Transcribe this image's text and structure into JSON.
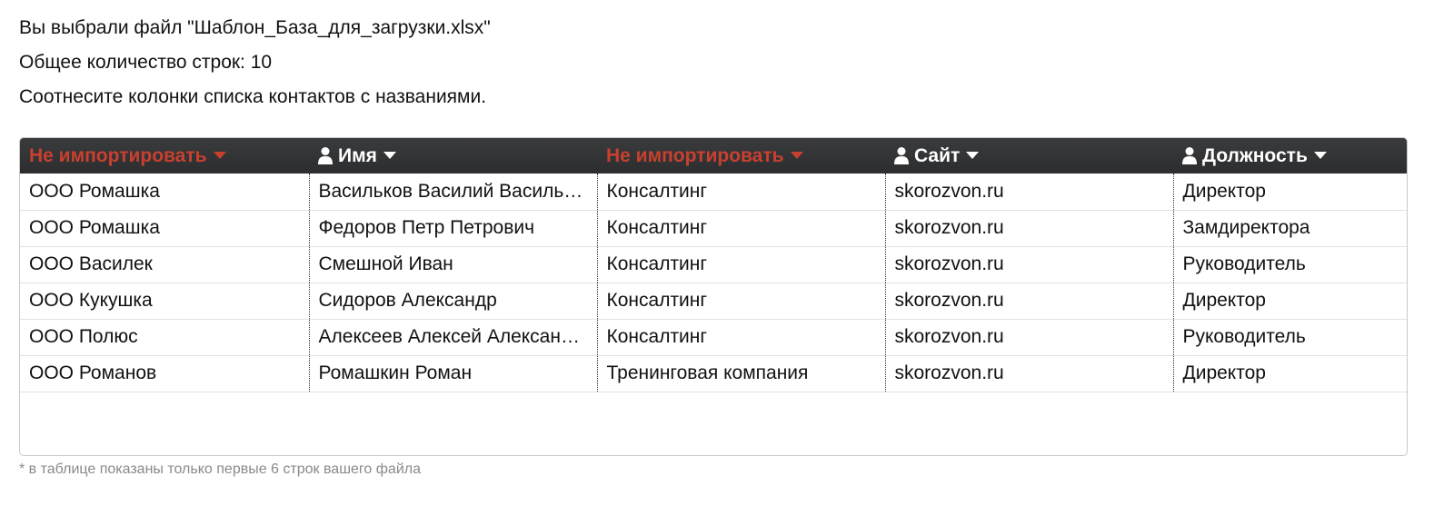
{
  "intro": {
    "file_line": "Вы выбрали файл \"Шаблон_База_для_загрузки.xlsx\"",
    "rows_line": "Общее количество строк: 10",
    "instruction": "Соотнесите колонки списка контактов с названиями."
  },
  "table": {
    "columns": [
      {
        "label": "Не импортировать",
        "icon": "",
        "state": "skip",
        "color": "#c9402f"
      },
      {
        "label": "Имя",
        "icon": "user-icon",
        "state": "mapped",
        "color": "#ffffff"
      },
      {
        "label": "Не импортировать",
        "icon": "",
        "state": "skip",
        "color": "#c9402f"
      },
      {
        "label": "Сайт",
        "icon": "user-icon",
        "state": "mapped",
        "color": "#ffffff"
      },
      {
        "label": "Должность",
        "icon": "user-icon",
        "state": "mapped",
        "color": "#ffffff"
      }
    ],
    "rows": [
      [
        "ООО Ромашка",
        "Васильков Василий Васильевич",
        "Консалтинг",
        "skorozvon.ru",
        "Директор"
      ],
      [
        "ООО Ромашка",
        "Федоров Петр Петрович",
        "Консалтинг",
        "skorozvon.ru",
        "Замдиректора"
      ],
      [
        "ООО Василек",
        "Смешной Иван",
        "Консалтинг",
        "skorozvon.ru",
        "Руководитель"
      ],
      [
        "ООО Кукушка",
        "Сидоров Александр",
        "Консалтинг",
        "skorozvon.ru",
        "Директор"
      ],
      [
        "ООО Полюс",
        "Алексеев Алексей Александрович",
        "Консалтинг",
        "skorozvon.ru",
        "Руководитель"
      ],
      [
        "ООО Романов",
        "Ромашкин Роман",
        "Тренинговая компания",
        "skorozvon.ru",
        "Директор"
      ]
    ]
  },
  "footnote": "* в таблице показаны только первые 6 строк вашего файла",
  "colors": {
    "header_bg": "#2f3032",
    "skip_red": "#c9402f",
    "footnote_gray": "#8a8a8a"
  }
}
